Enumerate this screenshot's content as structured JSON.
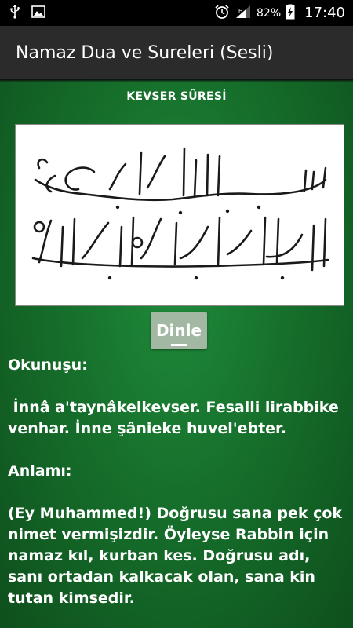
{
  "status_bar": {
    "icons_left": [
      "usb-icon",
      "image-icon"
    ],
    "icons_right": [
      "alarm-icon",
      "signal-icon",
      "battery-charging-icon"
    ],
    "battery": "82%",
    "time": "17:40"
  },
  "action_bar": {
    "title": "Namaz Dua ve Sureleri (Sesli)"
  },
  "sure": {
    "title": "KEVSER SÛRESİ",
    "image_alt": "Arabic calligraphy of Kevser Suresi",
    "listen_label": "Dinle",
    "reading_label": "Okunuşu:",
    "reading_text": " İnnâ a'taynâkelkevser. Fesalli lirabbike venhar. İnne şânieke huvel'ebter.",
    "meaning_label": "Anlamı:",
    "meaning_text": "(Ey Muhammed!) Doğrusu sana pek çok nimet vermişizdir. Öyleyse Rabbin için namaz kıl, kurban kes. Doğrusu adı, sanı ortadan kalkacak olan, sana kin tutan kimsedir."
  },
  "colors": {
    "background_green": "#166f2b",
    "action_bar": "#2b2b2b",
    "button": "#a3b8a3"
  }
}
